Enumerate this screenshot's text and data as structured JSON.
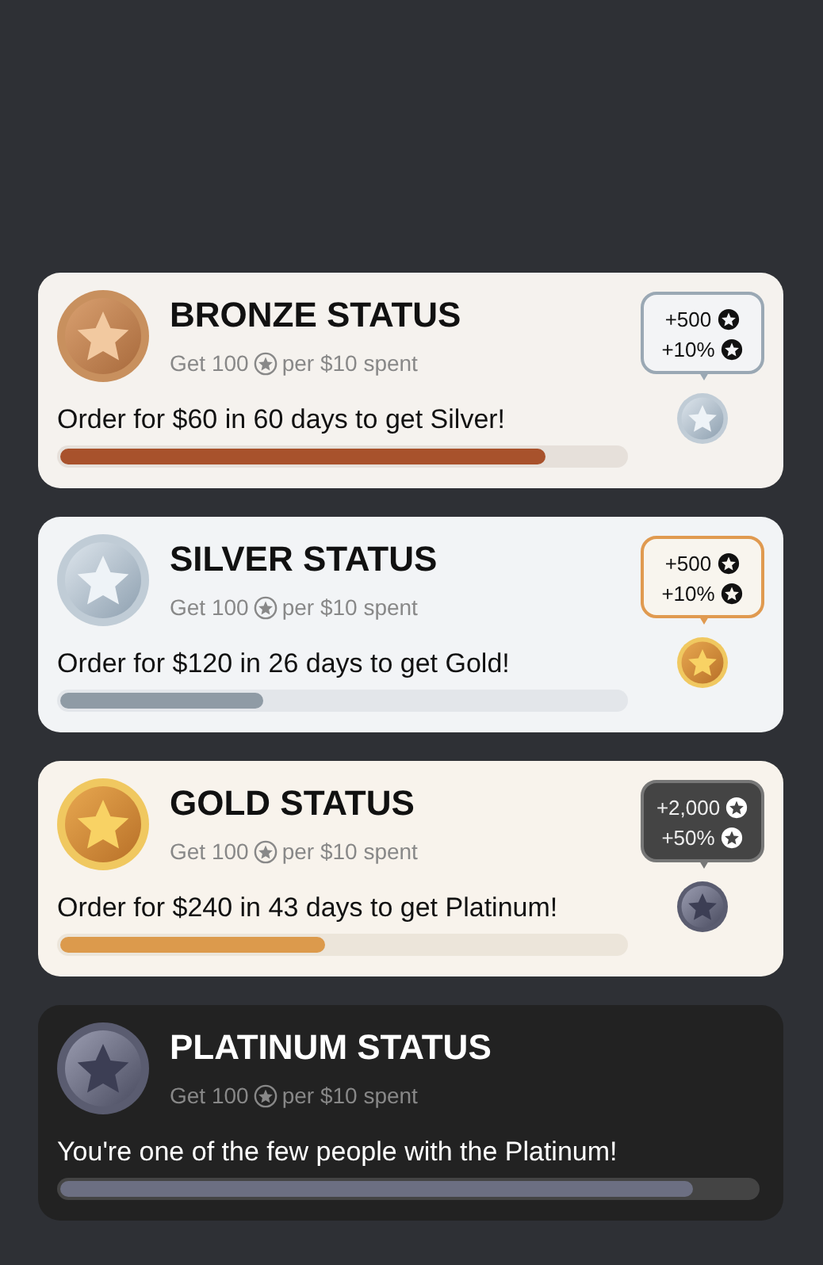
{
  "cards": [
    {
      "kind": "bronze",
      "title": "BRONZE STATUS",
      "earn": {
        "before": "Get 100",
        "after": "per $10 spent"
      },
      "message": "Order for $60 in 60 days to get Silver!",
      "level": 0.86,
      "next": {
        "kind": "silver",
        "bonuses": [
          "+500",
          "+10%"
        ]
      }
    },
    {
      "kind": "silver",
      "title": "SILVER STATUS",
      "earn": {
        "before": "Get 100",
        "after": "per $10 spent"
      },
      "message": "Order for $120 in 26 days to get Gold!",
      "level": 0.36,
      "next": {
        "kind": "gold",
        "bonuses": [
          "+500",
          "+10%"
        ]
      }
    },
    {
      "kind": "gold",
      "title": "GOLD STATUS",
      "earn": {
        "before": "Get 100",
        "after": "per $10 spent"
      },
      "message": "Order for $240 in 43 days to get Platinum!",
      "level": 0.47,
      "next": {
        "kind": "platinum",
        "bonuses": [
          "+2,000",
          "+50%"
        ]
      }
    },
    {
      "kind": "platinum",
      "title": "PLATINUM STATUS",
      "earn": {
        "before": "Get 100",
        "after": "per $10 spent"
      },
      "message": "You're one of the few people with the Platinum!",
      "level": 0.91
    }
  ]
}
